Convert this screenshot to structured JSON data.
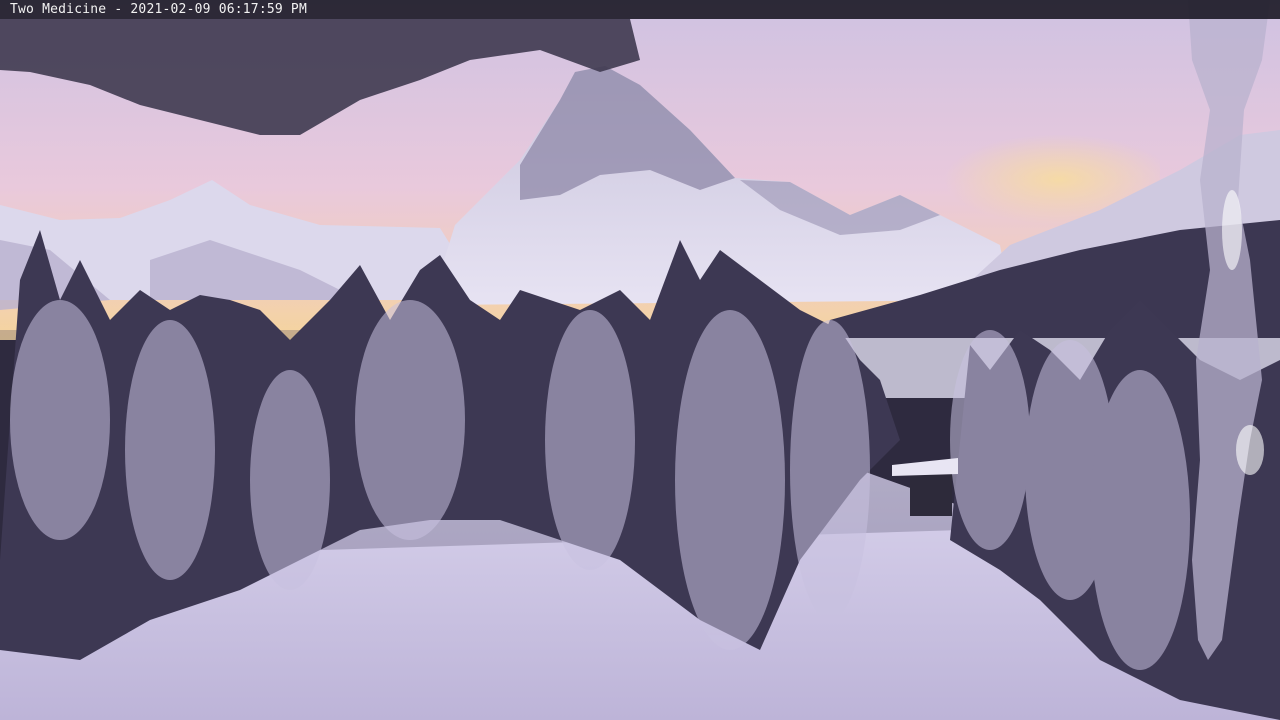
{
  "webcam": {
    "location": "Two Medicine",
    "date": "2021-02-09",
    "time": "06:17:59 PM",
    "caption": "Two Medicine - 2021-02-09 06:17:59 PM"
  },
  "colors": {
    "sky_top": "#d9cce6",
    "sky_glow": "#f6d6a6",
    "snow": "#e6e2f4",
    "trees": "#3a3550",
    "overlay_bar": "#1e1c28"
  }
}
